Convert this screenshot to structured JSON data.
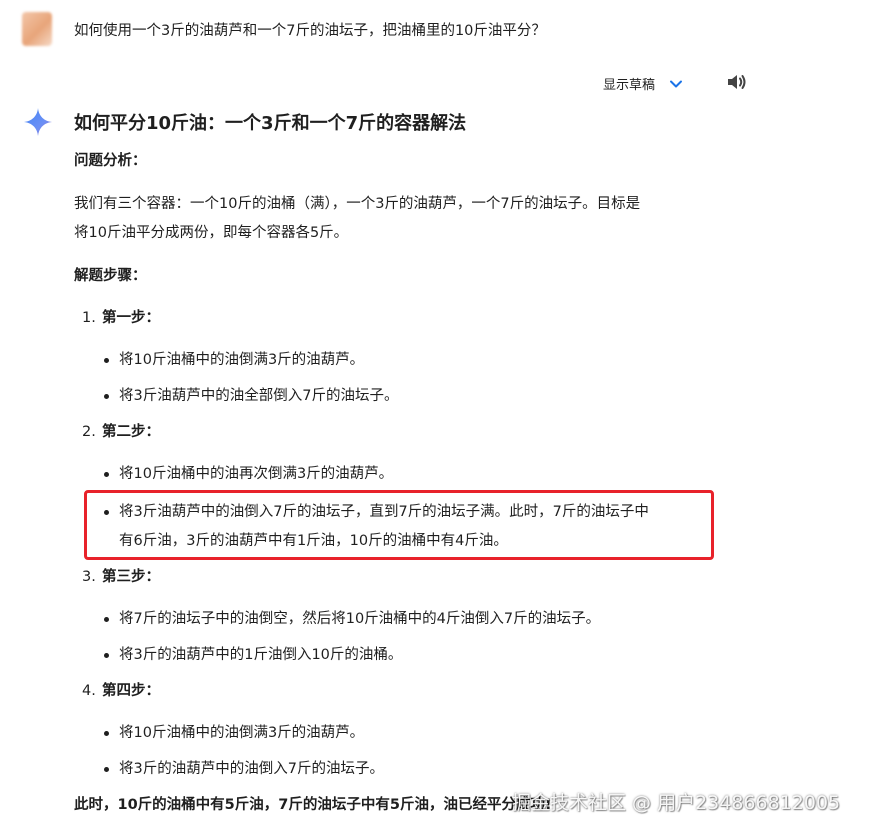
{
  "prompt": {
    "text": "如何使用一个3斤的油葫芦和一个7斤的油坛子，把油桶里的10斤油平分？"
  },
  "toolbar": {
    "show_drafts": "显示草稿",
    "chevron_icon": "chevron-down-icon",
    "speaker_icon": "speaker-icon"
  },
  "answer": {
    "title": "如何平分10斤油：一个3斤和一个7斤的容器解法",
    "analysis_label": "问题分析：",
    "analysis_line1": "我们有三个容器：一个10斤的油桶（满），一个3斤的油葫芦，一个7斤的油坛子。目标是",
    "analysis_line2": "将10斤油平分成两份，即每个容器各5斤。",
    "steps_label": "解题步骤：",
    "steps": [
      {
        "num": "1.",
        "label": "第一步：",
        "bullets": [
          "将10斤油桶中的油倒满3斤的油葫芦。",
          "将3斤油葫芦中的油全部倒入7斤的油坛子。"
        ]
      },
      {
        "num": "2.",
        "label": "第二步：",
        "bullets": [
          "将10斤油桶中的油再次倒满3斤的油葫芦。",
          "将3斤油葫芦中的油倒入7斤的油坛子，直到7斤的油坛子满。此时，7斤的油坛子中",
          "有6斤油，3斤的油葫芦中有1斤油，10斤的油桶中有4斤油。"
        ]
      },
      {
        "num": "3.",
        "label": "第三步：",
        "bullets": [
          "将7斤的油坛子中的油倒空，然后将10斤油桶中的4斤油倒入7斤的油坛子。",
          "将3斤的油葫芦中的1斤油倒入10斤的油桶。"
        ]
      },
      {
        "num": "4.",
        "label": "第四步：",
        "bullets": [
          "将10斤油桶中的油倒满3斤的油葫芦。",
          "将3斤的油葫芦中的油倒入7斤的油坛子。"
        ]
      }
    ],
    "conclusion": "此时，10斤的油桶中有5斤油，7斤的油坛子中有5斤油，油已经平分成功!"
  },
  "watermark": "掘金技术社区 @ 用户234866812005",
  "colors": {
    "highlight_border": "#e8222a",
    "accent_blue": "#1a73e8"
  }
}
